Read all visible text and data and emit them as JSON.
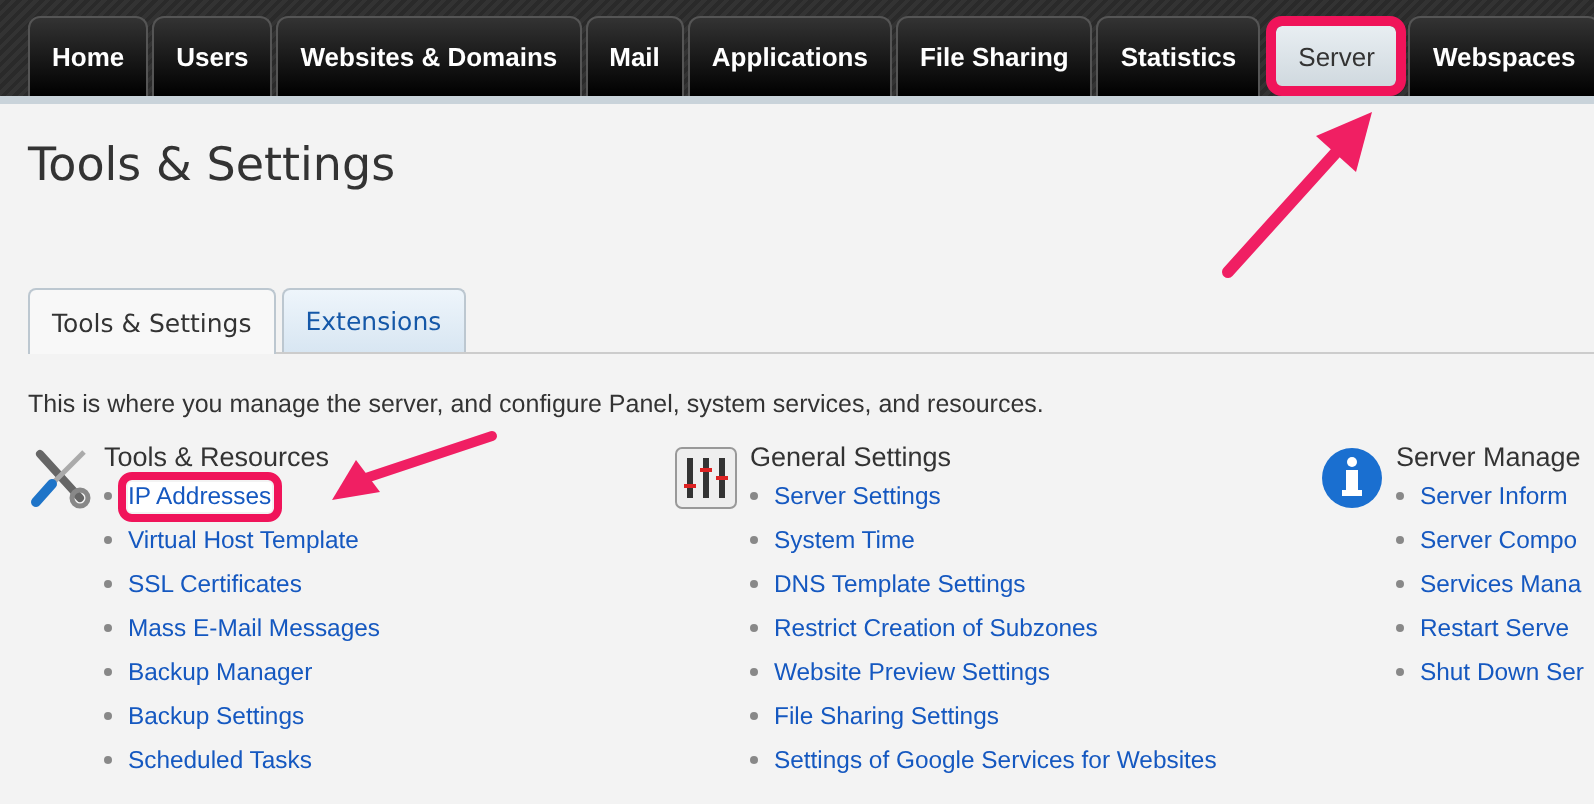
{
  "nav_tabs": [
    {
      "label": "Home",
      "selected": false,
      "highlighted": false
    },
    {
      "label": "Users",
      "selected": false,
      "highlighted": false
    },
    {
      "label": "Websites & Domains",
      "selected": false,
      "highlighted": false
    },
    {
      "label": "Mail",
      "selected": false,
      "highlighted": false
    },
    {
      "label": "Applications",
      "selected": false,
      "highlighted": false
    },
    {
      "label": "File Sharing",
      "selected": false,
      "highlighted": false
    },
    {
      "label": "Statistics",
      "selected": false,
      "highlighted": false
    },
    {
      "label": "Server",
      "selected": true,
      "highlighted": true
    },
    {
      "label": "Webspaces",
      "selected": false,
      "highlighted": false
    }
  ],
  "page_title": "Tools & Settings",
  "tabs": [
    {
      "label": "Tools & Settings",
      "selected": true
    },
    {
      "label": "Extensions",
      "selected": false
    }
  ],
  "description": "This is where you manage the server, and configure Panel, system services, and resources.",
  "sections": [
    {
      "kind": "tools",
      "title": "Tools & Resources",
      "links": [
        {
          "label": "IP Addresses",
          "highlighted": true
        },
        {
          "label": "Virtual Host Template",
          "highlighted": false
        },
        {
          "label": "SSL Certificates",
          "highlighted": false
        },
        {
          "label": "Mass E-Mail Messages",
          "highlighted": false
        },
        {
          "label": "Backup Manager",
          "highlighted": false
        },
        {
          "label": "Backup Settings",
          "highlighted": false
        },
        {
          "label": "Scheduled Tasks",
          "highlighted": false
        }
      ]
    },
    {
      "kind": "sliders",
      "title": "General Settings",
      "links": [
        {
          "label": "Server Settings",
          "highlighted": false
        },
        {
          "label": "System Time",
          "highlighted": false
        },
        {
          "label": "DNS Template Settings",
          "highlighted": false
        },
        {
          "label": "Restrict Creation of Subzones",
          "highlighted": false
        },
        {
          "label": "Website Preview Settings",
          "highlighted": false
        },
        {
          "label": "File Sharing Settings",
          "highlighted": false
        },
        {
          "label": "Settings of Google Services for Websites",
          "highlighted": false
        }
      ]
    },
    {
      "kind": "info",
      "title": "Server Manage",
      "links": [
        {
          "label": "Server Inform",
          "highlighted": false
        },
        {
          "label": "Server Compo",
          "highlighted": false
        },
        {
          "label": "Services Mana",
          "highlighted": false
        },
        {
          "label": "Restart Serve",
          "highlighted": false
        },
        {
          "label": "Shut Down Ser",
          "highlighted": false
        }
      ]
    }
  ]
}
